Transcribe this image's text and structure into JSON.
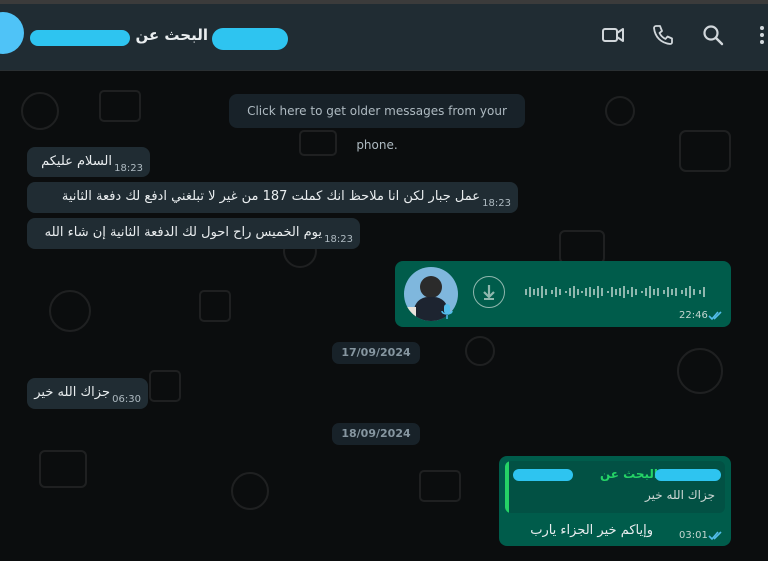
{
  "header": {
    "title": "البحث عن",
    "icons": [
      "video-call-icon",
      "phone-icon",
      "search-icon",
      "menu-icon"
    ]
  },
  "chat": {
    "older_messages": "Click here to get older messages from your phone.",
    "messages": [
      {
        "text": "السلام عليكم",
        "time": "18:23"
      },
      {
        "text": "عمل جبار لكن انا ملاحظ انك كملت 187 من غير لا تبلغني ادفع لك دفعة الثانية",
        "time": "18:23"
      },
      {
        "text": "يوم الخميس راح احول لك الدفعة الثانية إن شاء الله",
        "time": "18:23"
      }
    ],
    "voice_note": {
      "time": "22:46"
    },
    "date1": "17/09/2024",
    "reply_in": {
      "text": "جزاك الله خير",
      "time": "06:30"
    },
    "date2": "18/09/2024",
    "reply_out": {
      "quoted_name": "البحث عن",
      "quoted_text": "جزاك الله خير",
      "text": "وإياكم خير الجزاء يارب",
      "time": "03:01"
    }
  },
  "colors": {
    "incoming": "#202c33",
    "outgoing": "#005c4b",
    "read_tick": "#53bdeb",
    "quoted_name": "#25d366"
  }
}
